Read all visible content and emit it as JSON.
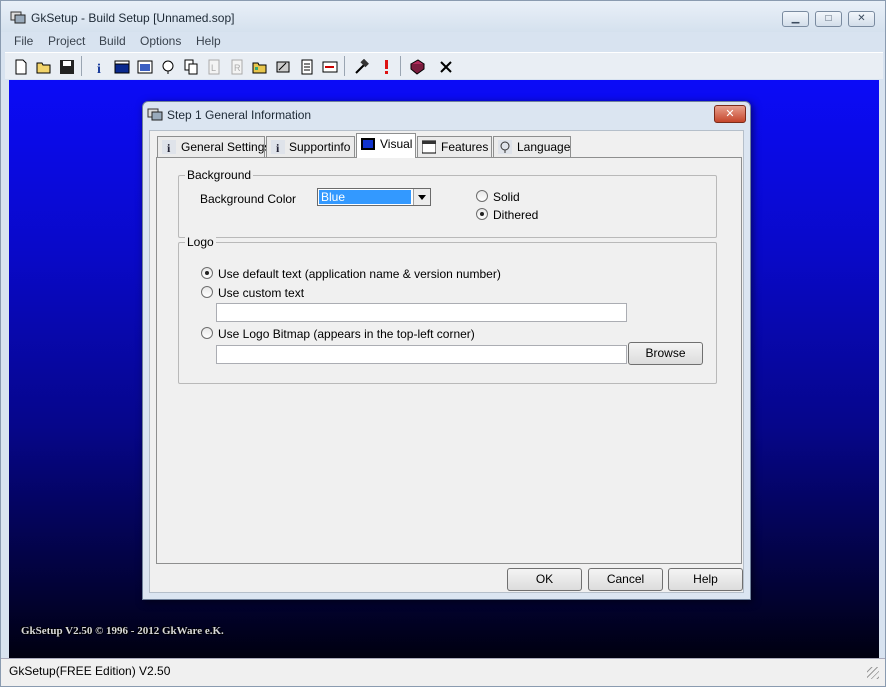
{
  "window": {
    "title": "GkSetup - Build Setup [Unnamed.sop]",
    "minimize": "▁",
    "maximize": "□",
    "close": "✕"
  },
  "menu": [
    "File",
    "Project",
    "Build",
    "Options",
    "Help"
  ],
  "toolbar": {
    "icons": [
      "new-file-icon",
      "open-folder-icon",
      "save-icon",
      "info-icon",
      "window-icon",
      "settings-window-icon",
      "language-icon",
      "copy-icon",
      "license-icon",
      "readme-icon",
      "folder-icon",
      "wizard-icon",
      "script-icon",
      "shortcut-icon",
      "build-hammer-icon",
      "run-exclamation-icon",
      "help-book-icon",
      "exit-x-icon"
    ]
  },
  "dialog": {
    "title": "Step 1 General Information",
    "close_label": "✕",
    "tabs": [
      {
        "label": "General Settings",
        "icon": "info-icon"
      },
      {
        "label": "Supportinfo",
        "icon": "info-icon"
      },
      {
        "label": "Visual",
        "icon": "screen-icon"
      },
      {
        "label": "Features",
        "icon": "window-icon"
      },
      {
        "label": "Language",
        "icon": "language-icon"
      }
    ],
    "background": {
      "legend": "Background",
      "color_label": "Background Color",
      "color_value": "Blue",
      "solid_label": "Solid",
      "dithered_label": "Dithered",
      "selected": "Dithered"
    },
    "logo": {
      "legend": "Logo",
      "default_text_label": "Use default text (application name & version number)",
      "custom_text_label": "Use custom text",
      "custom_text_value": "",
      "bitmap_label": "Use Logo Bitmap (appears in the top-left corner)",
      "bitmap_value": "",
      "browse_label": "Browse",
      "selected": "default"
    },
    "buttons": {
      "ok": "OK",
      "cancel": "Cancel",
      "help": "Help"
    }
  },
  "copyright": "GkSetup V2.50 © 1996 - 2012 GkWare e.K.",
  "status": "GkSetup(FREE Edition) V2.50",
  "colors": {
    "desktop_top": "#0b0bf7",
    "desktop_bottom": "#000010",
    "selection": "#3399ff"
  }
}
